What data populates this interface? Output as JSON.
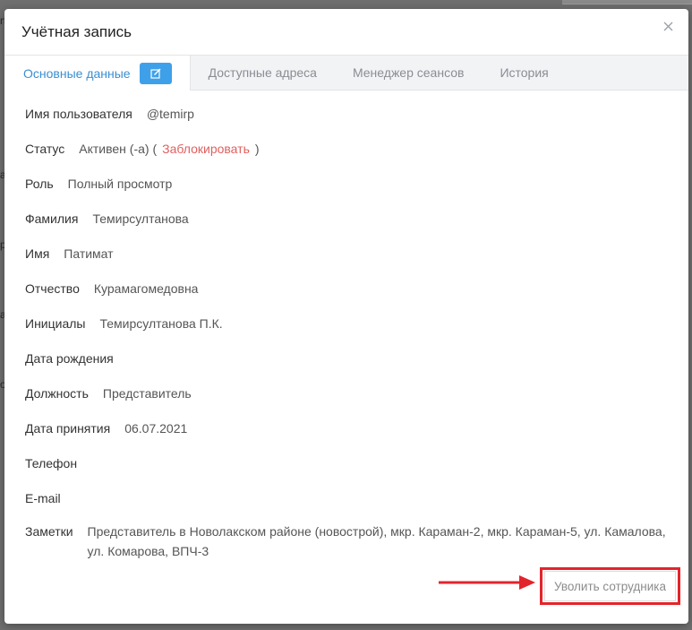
{
  "modal": {
    "title": "Учётная запись"
  },
  "tabs": [
    {
      "label": "Основные данные",
      "active": true
    },
    {
      "label": "Доступные адреса"
    },
    {
      "label": "Менеджер сеансов"
    },
    {
      "label": "История"
    }
  ],
  "fields": {
    "username": {
      "label": "Имя пользователя",
      "value": "@temirp"
    },
    "status": {
      "label": "Статус",
      "value": "Активен (-а) (",
      "action": "Заблокировать",
      "close": ")"
    },
    "role": {
      "label": "Роль",
      "value": "Полный просмотр"
    },
    "lastname": {
      "label": "Фамилия",
      "value": "Темирсултанова"
    },
    "firstname": {
      "label": "Имя",
      "value": "Патимат"
    },
    "patronymic": {
      "label": "Отчество",
      "value": "Курамагомедовна"
    },
    "initials": {
      "label": "Инициалы",
      "value": "Темирсултанова П.К."
    },
    "birthdate": {
      "label": "Дата рождения",
      "value": ""
    },
    "position": {
      "label": "Должность",
      "value": "Представитель"
    },
    "hire_date": {
      "label": "Дата принятия",
      "value": "06.07.2021"
    },
    "phone": {
      "label": "Телефон",
      "value": ""
    },
    "email": {
      "label": "E-mail",
      "value": ""
    },
    "notes": {
      "label": "Заметки",
      "value": "Представитель в Новолакском районе (новострой), мкр. Караман-2, мкр. Караман-5, ул. Камалова, ул. Комарова, ВПЧ-3"
    }
  },
  "actions": {
    "fire_label": "Уволить сотрудника"
  },
  "colors": {
    "accent": "#3a8fd1",
    "edit_button": "#3fa0ea",
    "danger_link": "#e0605f",
    "highlight": "#e3242b"
  },
  "background_fragments": [
    "n",
    "a",
    "p",
    "a",
    "o"
  ]
}
